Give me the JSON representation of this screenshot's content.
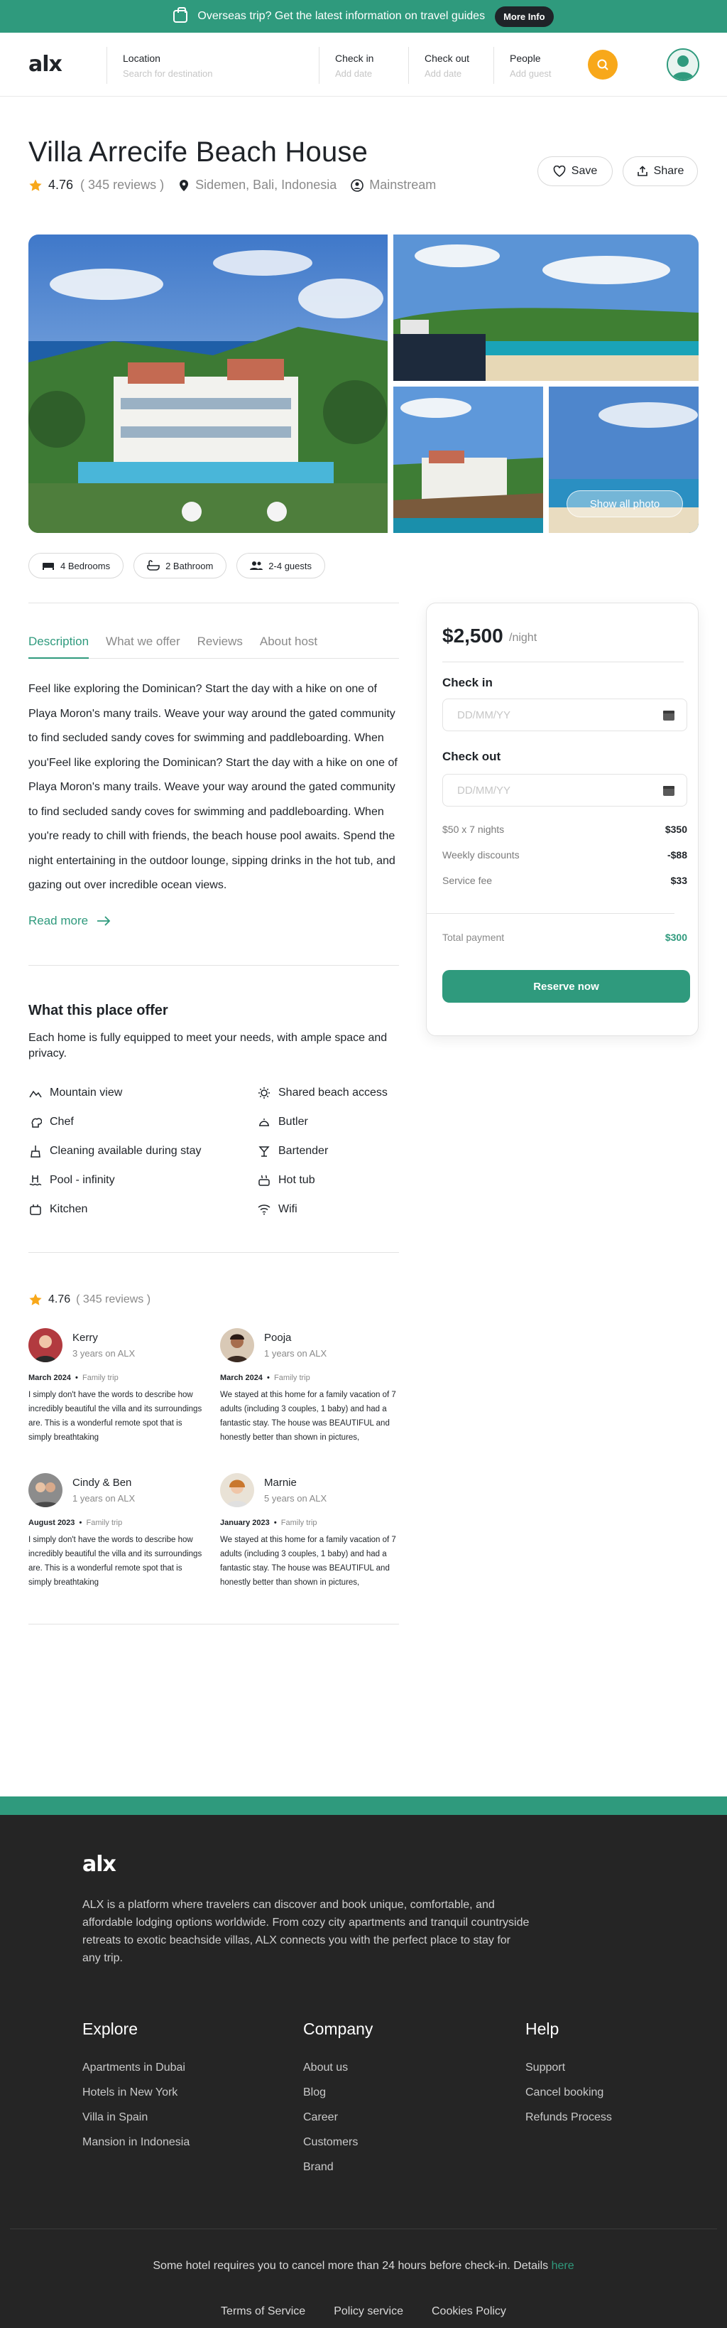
{
  "banner": {
    "text": "Overseas trip? Get the latest information on travel guides",
    "button": "More Info"
  },
  "header": {
    "logo": "alx",
    "search": {
      "location_label": "Location",
      "location_placeholder": "Search for destination",
      "checkin_label": "Check in",
      "checkin_placeholder": "Add date",
      "checkout_label": "Check out",
      "checkout_placeholder": "Add date",
      "people_label": "People",
      "people_placeholder": "Add guest"
    }
  },
  "listing": {
    "title": "Villa Arrecife Beach House",
    "rating": "4.76",
    "reviews": "( 345 reviews )",
    "location": "Sidemen, Bali, Indonesia",
    "category": "Mainstream",
    "save_label": "Save",
    "share_label": "Share",
    "show_all": "Show all photo",
    "features": [
      "4 Bedrooms",
      "2 Bathroom",
      "2-4 guests"
    ]
  },
  "tabs": [
    "Description",
    "What we offer",
    "Reviews",
    "About host"
  ],
  "description": "Feel like exploring the Dominican? Start the day with a hike on one of Playa Moron's many trails. Weave your way around the gated community to find secluded sandy coves for swimming and paddleboarding. When you'Feel like exploring the Dominican? Start the day with a hike on one of Playa Moron's many trails. Weave your way around the gated community to find secluded sandy coves for swimming and paddleboarding. When you're ready to chill with friends, the beach house pool awaits. Spend the night entertaining in the outdoor lounge, sipping drinks in the hot tub, and gazing out over incredible ocean views.",
  "read_more": "Read more",
  "offer": {
    "title": "What this place offer",
    "subtitle": "Each home is fully equipped to meet your needs, with ample space and privacy.",
    "items": [
      "Mountain view",
      "Shared beach access",
      "Chef",
      "Butler",
      "Cleaning available during stay",
      "Bartender",
      "Pool - infinity",
      "Hot tub",
      "Kitchen",
      "Wifi"
    ]
  },
  "reviews_section": {
    "rating": "4.76",
    "count": "( 345 reviews )",
    "items": [
      {
        "name": "Kerry",
        "years": "3 years on ALX",
        "date": "March 2024",
        "trip": "Family trip",
        "text": "I simply don't have the words to describe how incredibly beautiful the villa and its surroundings are. This is a wonderful remote spot that is simply breathtaking"
      },
      {
        "name": "Pooja",
        "years": "1 years on ALX",
        "date": "March 2024",
        "trip": "Family trip",
        "text": "We stayed at this home for a family vacation of 7 adults (including 3 couples, 1 baby) and had a fantastic stay. The house was BEAUTIFUL and honestly better than shown in pictures,"
      },
      {
        "name": "Cindy & Ben",
        "years": "1 years on ALX",
        "date": "August 2023",
        "trip": "Family trip",
        "text": "I simply don't have the words to describe how incredibly beautiful the villa and its surroundings are. This is a wonderful remote spot that is simply breathtaking"
      },
      {
        "name": "Marnie",
        "years": "5 years on ALX",
        "date": "January 2023",
        "trip": "Family trip",
        "text": "We stayed at this home for a family vacation of 7 adults (including 3 couples, 1 baby) and had a fantastic stay. The house was BEAUTIFUL and honestly better than shown in pictures,"
      }
    ]
  },
  "booking": {
    "price": "$2,500",
    "per": "/night",
    "checkin_label": "Check in",
    "checkout_label": "Check out",
    "date_placeholder": "DD/MM/YY",
    "lines": [
      {
        "label": "$50 x 7 nights",
        "value": "$350"
      },
      {
        "label": "Weekly discounts",
        "value": "-$88"
      },
      {
        "label": "Service fee",
        "value": "$33"
      }
    ],
    "total_label": "Total payment",
    "total_value": "$300",
    "reserve": "Reserve now"
  },
  "footer": {
    "logo": "alx",
    "about": "ALX is a platform where travelers can discover and book unique, comfortable, and affordable lodging options worldwide. From cozy city apartments and tranquil countryside retreats to exotic beachside villas, ALX connects you with the perfect place to stay for any trip.",
    "explore_title": "Explore",
    "explore": [
      "Apartments in Dubai",
      "Hotels in New York",
      "Villa in Spain",
      "Mansion in Indonesia"
    ],
    "company_title": "Company",
    "company": [
      "About us",
      "Blog",
      "Career",
      "Customers",
      "Brand"
    ],
    "help_title": "Help",
    "help": [
      "Support",
      "Cancel booking",
      "Refunds Process"
    ],
    "note": "Some hotel requires you to cancel more than 24 hours before check-in. Details",
    "note_link": "here",
    "links": [
      "Terms of Service",
      "Policy service",
      "Cookies Policy"
    ]
  },
  "colors": {
    "accent": "#2f9a7d",
    "search_button": "#f8a81a",
    "star": "#f8a81a",
    "footer_bg": "#252525"
  }
}
